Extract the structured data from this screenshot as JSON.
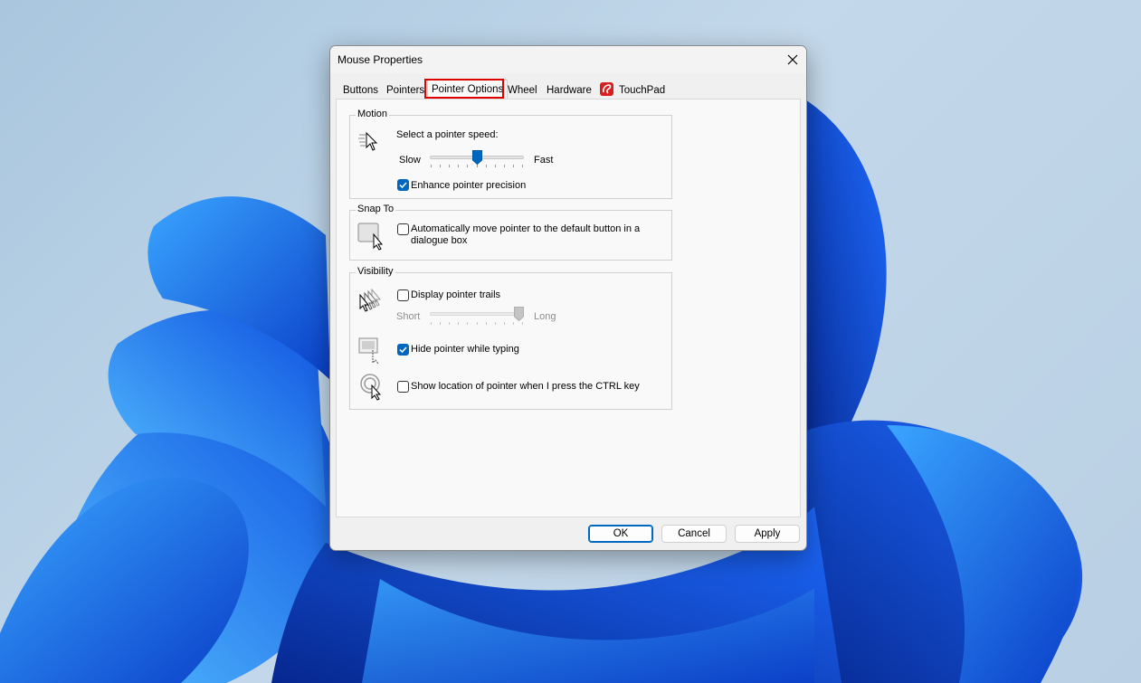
{
  "dialog": {
    "title": "Mouse Properties",
    "tabs": [
      {
        "label": "Buttons"
      },
      {
        "label": "Pointers"
      },
      {
        "label": "Pointer Options",
        "active": true
      },
      {
        "label": "Wheel"
      },
      {
        "label": "Hardware"
      },
      {
        "label": "TouchPad"
      }
    ],
    "motion": {
      "heading": "Motion",
      "speed_label": "Select a pointer speed:",
      "slow_label": "Slow",
      "fast_label": "Fast",
      "speed_level": 0.5,
      "enhance_precision": {
        "label": "Enhance pointer precision",
        "checked": true
      }
    },
    "snap_to": {
      "heading": "Snap To",
      "auto_move": {
        "label_line1": "Automatically move pointer to the default button in a",
        "label_line2": "dialogue box",
        "checked": false
      }
    },
    "visibility": {
      "heading": "Visibility",
      "trails": {
        "label": "Display pointer trails",
        "checked": false
      },
      "short_label": "Short",
      "long_label": "Long",
      "trail_level": 1.0,
      "hide_typing": {
        "label": "Hide pointer while typing",
        "checked": true
      },
      "show_ctrl": {
        "label": "Show location of pointer when I press the CTRL key",
        "checked": false
      }
    },
    "buttons": {
      "ok": "OK",
      "cancel": "Cancel",
      "apply": "Apply"
    }
  },
  "colors": {
    "accent": "#0067c0",
    "tab_highlight": "#e00000",
    "touchpad_icon": "#d81e1e"
  }
}
